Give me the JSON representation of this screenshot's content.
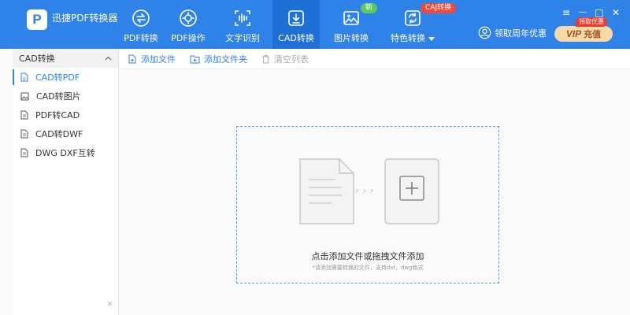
{
  "app": {
    "logo_letter": "P",
    "title": "迅捷PDF转换器"
  },
  "nav": {
    "tabs": [
      {
        "label": "PDF转换",
        "icon": "swap-circle-icon"
      },
      {
        "label": "PDF操作",
        "icon": "gear-circle-icon"
      },
      {
        "label": "文字识别",
        "icon": "text-scan-icon"
      },
      {
        "label": "CAD转换",
        "icon": "download-box-icon",
        "active": true
      },
      {
        "label": "图片转换",
        "icon": "image-icon",
        "badge": "新"
      },
      {
        "label": "特色转换",
        "icon": "refresh-box-icon",
        "badge": "CAJ转换",
        "has_dropdown": true
      }
    ]
  },
  "header_right": {
    "promo_label": "领取周年优惠",
    "vip_prefix": "VIP",
    "vip_label": "充值",
    "vip_tag": "领取优惠",
    "window": {
      "menu": "≡",
      "minimize": "—",
      "maximize": "□",
      "close": "✕"
    }
  },
  "sidebar": {
    "header": "CAD转换",
    "items": [
      {
        "label": "CAD转PDF",
        "active": true
      },
      {
        "label": "CAD转图片"
      },
      {
        "label": "PDF转CAD"
      },
      {
        "label": "CAD转DWF"
      },
      {
        "label": "DWG DXF互转"
      }
    ]
  },
  "toolbar": {
    "add_file": "添加文件",
    "add_folder": "添加文件夹",
    "clear_list": "清空列表"
  },
  "dropzone": {
    "arrows": "› › ›",
    "main_text": "点击添加文件或拖拽文件添加",
    "sub_text": "*请添加需要转换的文件，支持dxf，dwg格式"
  },
  "colors": {
    "brand": "#2f82e8",
    "active_tab": "#1e6fd6",
    "badge_new": "#5bc95b",
    "badge_caj": "#ef4a3c",
    "vip_bg": "#f6d9a6",
    "vip_text": "#a2552a"
  }
}
